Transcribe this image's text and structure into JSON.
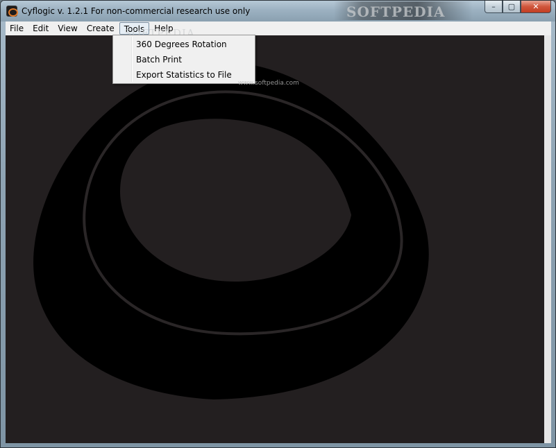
{
  "window": {
    "title": "Cyflogic v. 1.2.1 For non-commercial research use only",
    "watermark": "SOFTPEDIA",
    "buttons": {
      "minimize": "–",
      "maximize": "▢",
      "close": "✕"
    }
  },
  "menubar": {
    "items": [
      "File",
      "Edit",
      "View",
      "Create",
      "Tools",
      "Help"
    ],
    "open_item": "Tools",
    "watermark": "SOFTPEDIA",
    "sub_watermark": "www.softpedia.com"
  },
  "tools_menu": {
    "items": [
      "360 Degrees Rotation",
      "Batch Print",
      "Export Statistics to File"
    ]
  },
  "colors": {
    "viewport_bg": "#231f20",
    "shape_fill": "#000000",
    "ring_stroke": "#2a2627",
    "menu_bg": "#f0f0f0"
  },
  "icons": {
    "app": "cyflogic-app-icon",
    "minimize": "minimize-icon",
    "maximize": "maximize-icon",
    "close": "close-icon"
  }
}
